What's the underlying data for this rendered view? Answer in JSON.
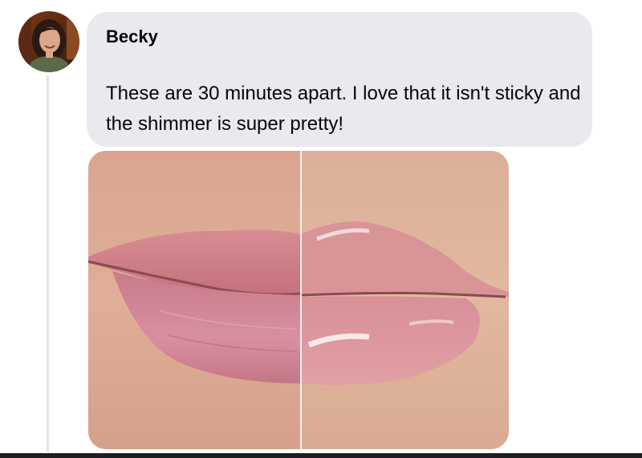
{
  "comment": {
    "author_name": "Becky",
    "message": "These are 30 minutes apart.  I love that it isn't sticky and the shimmer is super pretty!"
  },
  "avatar": {
    "icon": "profile-photo"
  },
  "attachment": {
    "icon": "lip-before-after-photo"
  },
  "colors": {
    "bubble": "#e9eaee",
    "text": "#050505",
    "thread_line": "#e4e6eb"
  }
}
